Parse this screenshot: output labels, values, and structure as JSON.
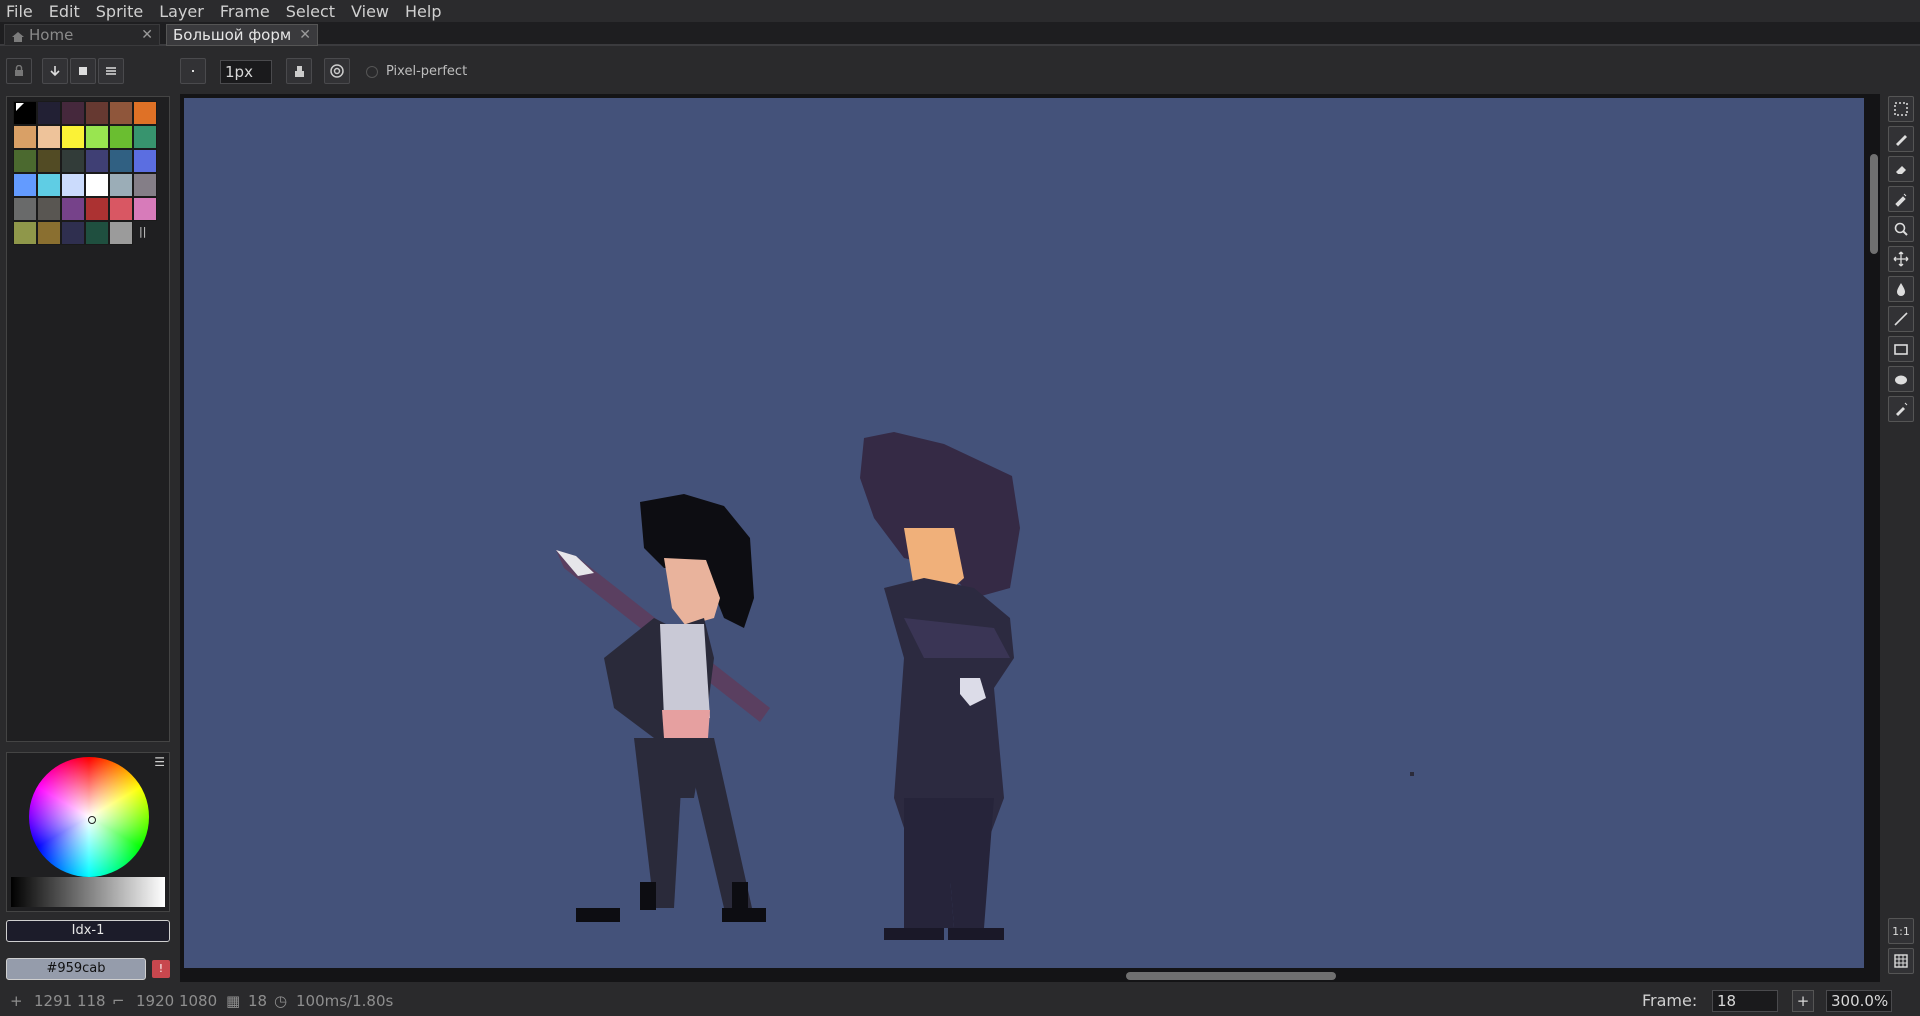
{
  "menu": [
    "File",
    "Edit",
    "Sprite",
    "Layer",
    "Frame",
    "Select",
    "View",
    "Help"
  ],
  "tabs": [
    {
      "label": "Home",
      "close": "✕"
    },
    {
      "label": "Большой форм",
      "close": "✕"
    }
  ],
  "toolbar": {
    "brush_size": "1px",
    "pixel_perfect_label": "Pixel-perfect"
  },
  "palette": {
    "colors": [
      "#000000",
      "#222034",
      "#45283c",
      "#663931",
      "#8f563b",
      "#df7126",
      "#d9a066",
      "#eec39a",
      "#fbf236",
      "#99e550",
      "#6abe30",
      "#37946e",
      "#4b692f",
      "#524b24",
      "#323c39",
      "#3f3f74",
      "#306082",
      "#5b6ee1",
      "#639bff",
      "#5fcde4",
      "#cbdbfc",
      "#ffffff",
      "#9badb7",
      "#847e87",
      "#696a6a",
      "#595652",
      "#76428a",
      "#ac3232",
      "#d95763",
      "#d77bba",
      "#8f974a",
      "#8a6f30",
      "#2f2f4f",
      "#1f4f3f",
      "#9b9b9b"
    ]
  },
  "color": {
    "index_label": "Idx-1",
    "hex": "#959cab",
    "primary": "#959cab",
    "warning_symbol": "!"
  },
  "status": {
    "cursor_pos": "1291 118",
    "canvas_size": "1920 1080",
    "frames": "18",
    "duration": "100ms/1.80s",
    "frame_label": "Frame:",
    "frame_value": "18",
    "add_frame": "+",
    "zoom": "300.0%"
  },
  "colors": {
    "canvas_bg": "#44527a",
    "app_bg": "#2a2a2c"
  },
  "icons": {
    "home": "home-icon",
    "tools": [
      "marquee-icon",
      "pencil-icon",
      "eraser-icon",
      "eyedropper-icon",
      "zoom-icon",
      "move-icon",
      "paint-bucket-icon",
      "line-icon",
      "rectangle-icon",
      "blur-icon",
      "spray-icon"
    ],
    "bottom_tools": [
      "one-to-one-icon",
      "timeline-icon"
    ]
  },
  "right_tools_bottom": {
    "one_to_one": "1:1"
  }
}
